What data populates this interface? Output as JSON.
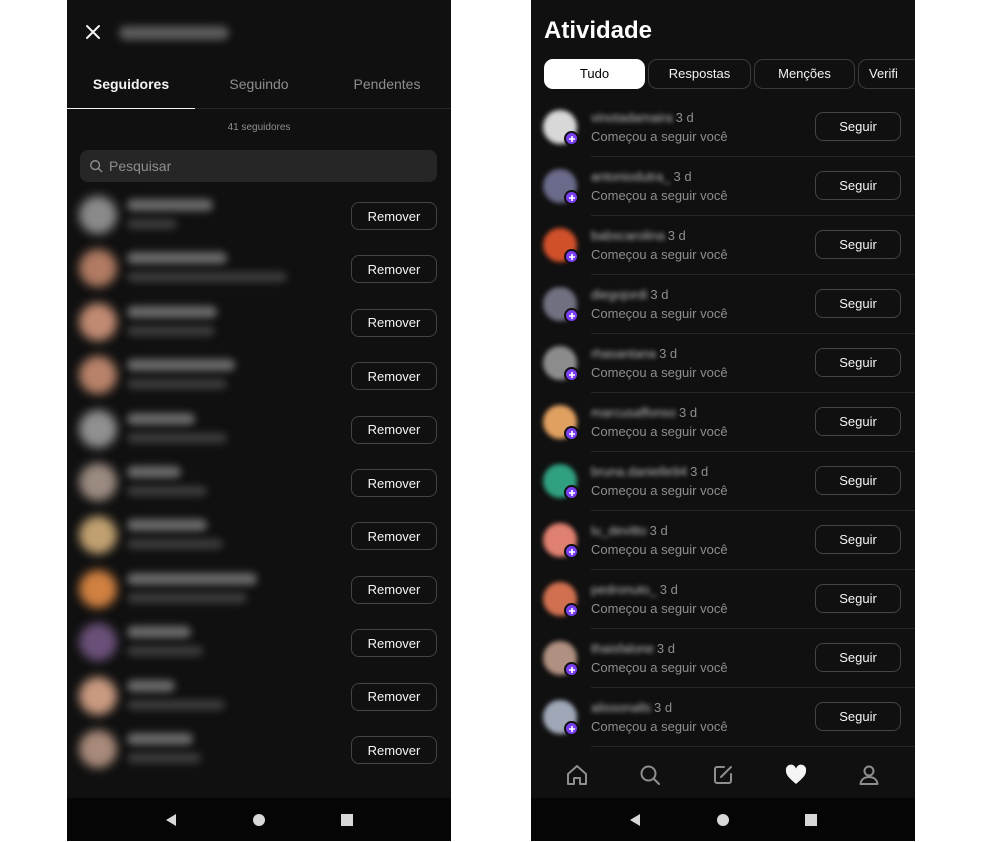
{
  "left": {
    "tabs": [
      "Seguidores",
      "Seguindo",
      "Pendentes"
    ],
    "follower_count": "41 seguidores",
    "search_placeholder": "Pesquisar",
    "remove_label": "Remover",
    "rows": [
      {
        "avatar_color": "#8a8a8a",
        "name_w": 86,
        "sub_w": 50
      },
      {
        "avatar_color": "#b07a62",
        "name_w": 100,
        "sub_w": 160
      },
      {
        "avatar_color": "#c08a72",
        "name_w": 90,
        "sub_w": 88
      },
      {
        "avatar_color": "#b8826a",
        "name_w": 108,
        "sub_w": 100
      },
      {
        "avatar_color": "#909090",
        "name_w": 68,
        "sub_w": 100
      },
      {
        "avatar_color": "#9a8a80",
        "name_w": 54,
        "sub_w": 80
      },
      {
        "avatar_color": "#c0a070",
        "name_w": 80,
        "sub_w": 96
      },
      {
        "avatar_color": "#d08040",
        "name_w": 130,
        "sub_w": 120
      },
      {
        "avatar_color": "#6a5078",
        "name_w": 64,
        "sub_w": 76
      },
      {
        "avatar_color": "#c89a80",
        "name_w": 48,
        "sub_w": 98
      },
      {
        "avatar_color": "#a88a7a",
        "name_w": 66,
        "sub_w": 74
      }
    ]
  },
  "right": {
    "title": "Atividade",
    "chips": [
      "Tudo",
      "Respostas",
      "Menções",
      "Verifi"
    ],
    "follow_label": "Seguir",
    "desc": "Começou a seguir você",
    "items": [
      {
        "username": "vinotadamaira",
        "time": "3 d",
        "avatar_color": "#d8d8d8"
      },
      {
        "username": "antoniodutra_",
        "time": "3 d",
        "avatar_color": "#6a6a8a"
      },
      {
        "username": "babscarolina",
        "time": "3 d",
        "avatar_color": "#d0502a"
      },
      {
        "username": "diegojordi",
        "time": "3 d",
        "avatar_color": "#707080"
      },
      {
        "username": "rhasantana",
        "time": "3 d",
        "avatar_color": "#8c8c8c"
      },
      {
        "username": "marcusaffonso",
        "time": "3 d",
        "avatar_color": "#e0a060"
      },
      {
        "username": "bruna.danielle94",
        "time": "3 d",
        "avatar_color": "#30a080"
      },
      {
        "username": "lu_devitto",
        "time": "3 d",
        "avatar_color": "#e08070"
      },
      {
        "username": "pedronuto_",
        "time": "3 d",
        "avatar_color": "#d07050"
      },
      {
        "username": "thaisfalone",
        "time": "3 d",
        "avatar_color": "#b09080"
      },
      {
        "username": "alissonalls",
        "time": "3 d",
        "avatar_color": "#a0a8b8"
      }
    ]
  },
  "colors": {
    "background": "#101010",
    "badge": "#7a3ff2",
    "muted_text": "#8e8e8e"
  }
}
